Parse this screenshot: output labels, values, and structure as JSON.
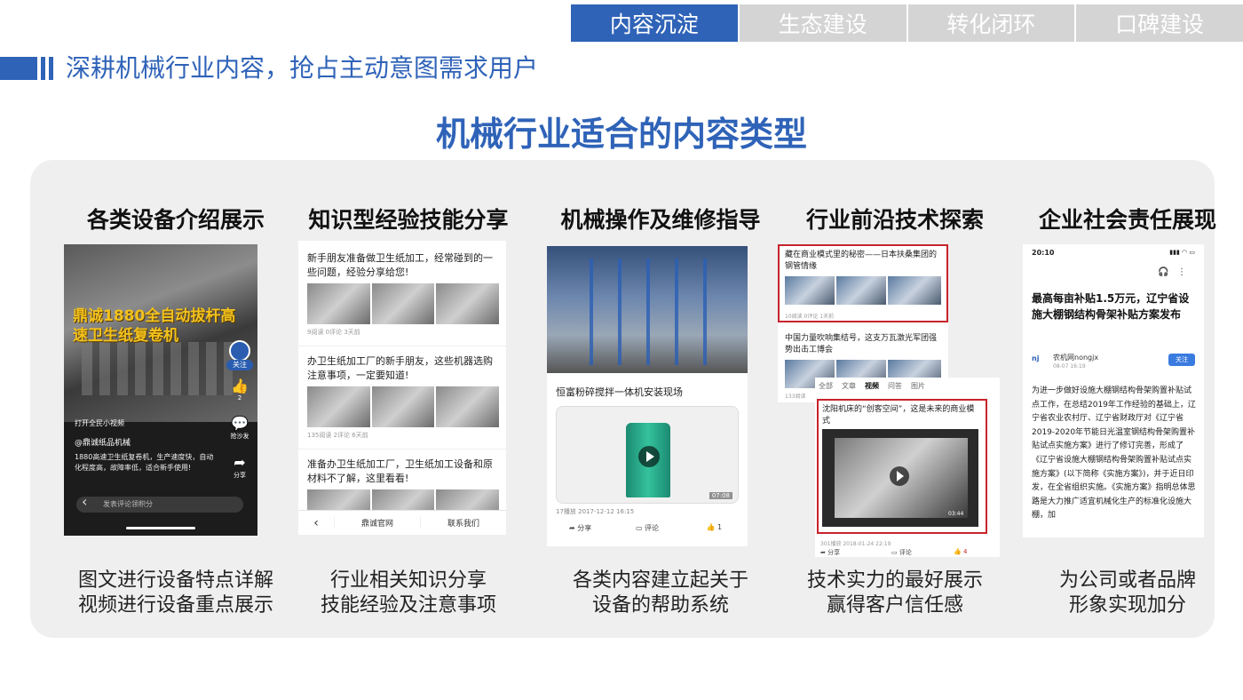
{
  "tabs": [
    "内容沉淀",
    "生态建设",
    "转化闭环",
    "口碑建设"
  ],
  "header_title": "深耕机械行业内容，抢占主动意图需求用户",
  "main_title": "机械行业适合的内容类型",
  "colors": {
    "accent": "#2f63b8",
    "tab_inactive": "#d4d4d4",
    "panel": "#efefef",
    "highlight": "#c8232c"
  },
  "columns": [
    {
      "title": "各类设备介绍展示",
      "desc": [
        "图文进行设备特点详解",
        "视频进行设备重点展示"
      ],
      "shot": {
        "video_title": "鼎诚1880全自动拔杆高速卫生纸复卷机",
        "follow": "关注",
        "like_count": "2",
        "share_label": "抢沙发",
        "forward_label": "分享",
        "live_label": "打开全民小视频",
        "account": "@鼎诚纸品机械",
        "info": "1880高速卫生纸复卷机，生产速度快，自动化程度高，故障率低，适合新手使用!",
        "comment_placeholder": "发表评论领积分"
      }
    },
    {
      "title": "知识型经验技能分享",
      "desc": [
        "行业相关知识分享",
        "技能经验及注意事项"
      ],
      "shot": {
        "articles": [
          {
            "title": "新手朋友准备做卫生纸加工，经常碰到的一些问题，经验分享给您!",
            "meta": "9阅读  0评论  3天前"
          },
          {
            "title": "办卫生纸加工厂的新手朋友，这些机器选购注意事项，一定要知道!",
            "meta": "135阅读  2评论  6天前"
          },
          {
            "title": "准备办卫生纸加工厂，卫生纸加工设备和原材料不了解，这里看看!",
            "meta": ""
          }
        ],
        "bar_items": [
          "鼎诚官网",
          "联系我们"
        ]
      }
    },
    {
      "title": "机械操作及维修指导",
      "desc": [
        "各类内容建立起关于",
        "设备的帮助系统"
      ],
      "shot": {
        "video_title": "恒富粉碎搅拌一体机安装现场",
        "duration": "07:08",
        "meta": "17播放  2017-12-12 16:15",
        "actions": [
          "分享",
          "评论",
          "1"
        ]
      }
    },
    {
      "title": "行业前沿技术探索",
      "desc": [
        "技术实力的最好展示",
        "赢得客户信任感"
      ],
      "shot": {
        "article1": "藏在商业模式里的秘密——日本扶桑集团的钢管情缘",
        "article1_meta": "10阅读  0评论  1天前",
        "article2": "中国力量吹响集结号，这支万瓦激光军团强势出击工博会",
        "article2_meta": "133阅读",
        "nav": [
          "全部",
          "文章",
          "视频",
          "问答",
          "图片"
        ],
        "video_title": "沈阳机床的“创客空间”，这是未来的商业模式",
        "video_meta": "301播放  2018-01-24 22:19",
        "duration": "03:44",
        "actions": [
          "分享",
          "评论",
          "4"
        ]
      }
    },
    {
      "title": "企业社会责任展现",
      "desc": [
        "为公司或者品牌",
        "形象实现加分"
      ],
      "shot": {
        "time": "20:10",
        "article_title": "最高每亩补贴1.5万元，辽宁省设施大棚钢结构骨架补贴方案发布",
        "author": "农机网nongjx",
        "date": "08-07 16:19",
        "follow": "关注",
        "body": "为进一步做好设施大棚钢结构骨架购置补贴试点工作，在总结2019年工作经验的基础上，辽宁省农业农村厅、辽宁省财政厅对《辽宁省2019-2020年节能日光温室钢结构骨架购置补贴试点实施方案》进行了修订完善，形成了《辽宁省设施大棚钢结构骨架购置补贴试点实施方案》(以下简称《实施方案》)，并于近日印发，在全省组织实施。《实施方案》指明总体思路是大力推广适宜机械化生产的标准化设施大棚，加"
      }
    }
  ]
}
